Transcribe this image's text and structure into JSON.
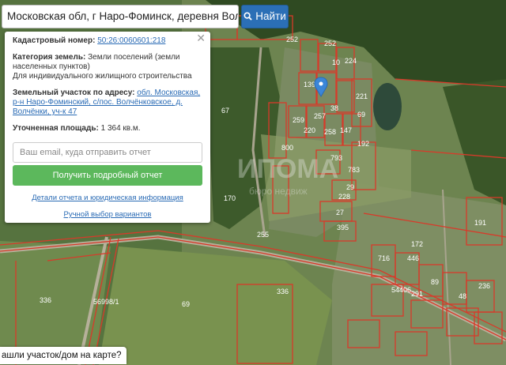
{
  "search": {
    "value": "Московская обл, г Наро-Фоминск, деревня Волчёнки",
    "button_label": "Найти"
  },
  "popup": {
    "cadastral_label": "Кадастровый номер:",
    "cadastral_value": "50:26:0060601:218",
    "category_label": "Категория земель:",
    "category_value": "Земли поселений (земли населенных пунктов)",
    "usage_value": "Для индивидуального жилищного строительства",
    "address_label": "Земельный участок по адресу:",
    "address_value": "обл. Московская, р-н Наро-Фоминский, с/пос. Волчёнковское, д. Волчёнки, уч-к 47",
    "area_label": "Уточненная площадь:",
    "area_value": "1 364 кв.м.",
    "email_placeholder": "Ваш email, куда отправить отчет",
    "report_button": "Получить подробный отчет",
    "details_link": "Детали отчета и юридическая информация",
    "manual_link": "Ручной выбор вариантов"
  },
  "question_label": "ашли участок/дом на карте?",
  "watermark_text": "ИПОМА",
  "watermark_sub": "бюро недвиж",
  "map_labels": [
    "252",
    "252",
    "10",
    "139",
    "224",
    "38",
    "221",
    "259",
    "220",
    "257",
    "258",
    "147",
    "69",
    "800",
    "192",
    "793",
    "783",
    "29",
    "228",
    "27",
    "170",
    "395",
    "255",
    "191",
    "446",
    "716",
    "172",
    "89",
    "48",
    "69",
    "336",
    "336",
    "56998/1",
    "54406",
    "236",
    "291",
    "67",
    "69"
  ],
  "colors": {
    "accent_blue": "#2b6fb6",
    "green_button": "#5cb85c",
    "parcel_red": "#d83a2a"
  }
}
